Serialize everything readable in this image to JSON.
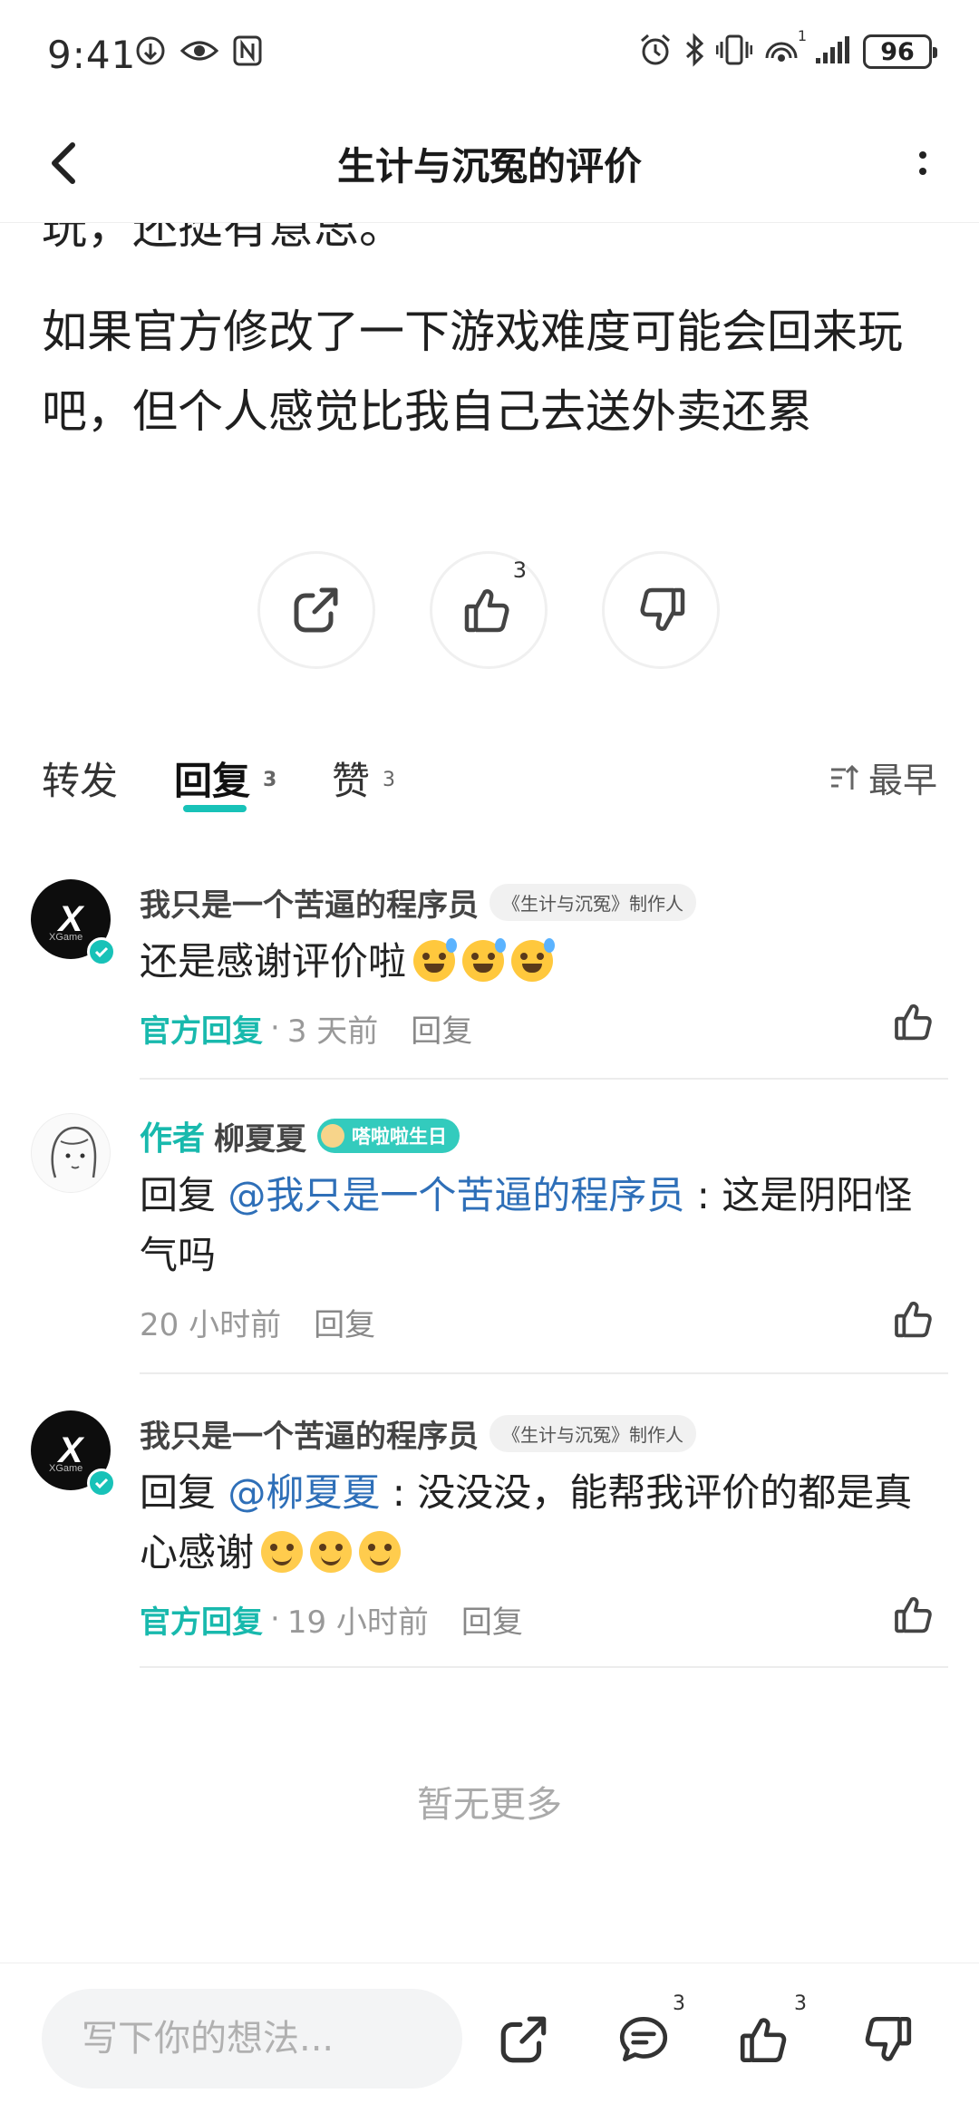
{
  "status_bar": {
    "time": "9:41",
    "battery": "96",
    "signal_sub": "1",
    "left_icons": [
      "data-saver-icon",
      "eye-icon",
      "nfc-icon"
    ],
    "right_icons": [
      "alarm-icon",
      "bluetooth-icon",
      "vibrate-icon",
      "hotspot-icon",
      "signal-icon",
      "battery-icon"
    ]
  },
  "header": {
    "title": "生计与沉冤的评价"
  },
  "review": {
    "clipped_line": "玩，还挺有意思。",
    "text": "如果官方修改了一下游戏难度可能会回来玩吧，但个人感觉比我自己去送外卖还累"
  },
  "actions": {
    "like_count": "3"
  },
  "tabs": {
    "repost": "转发",
    "reply": "回复",
    "reply_count": "3",
    "like": "赞",
    "like_count": "3",
    "sort": "最早"
  },
  "comments": [
    {
      "name": "我只是一个苦逼的程序员",
      "badge": "《生计与沉冤》制作人",
      "text": "还是感谢评价啦",
      "official": "官方回复",
      "time": "3 天前",
      "reply": "回复"
    },
    {
      "author_tag": "作者",
      "name": "柳夏夏",
      "badge": "嗒啦啦生日",
      "reply_prefix": "回复 ",
      "mention": "@我只是一个苦逼的程序员",
      "text": " : 这是阴阳怪气吗",
      "time": "20 小时前",
      "reply": "回复"
    },
    {
      "name": "我只是一个苦逼的程序员",
      "badge": "《生计与沉冤》制作人",
      "reply_prefix": "回复 ",
      "mention": "@柳夏夏",
      "text": " : 没没没，能帮我评价的都是真心感谢",
      "official": "官方回复",
      "time": "19 小时前",
      "reply": "回复"
    }
  ],
  "avatar_logo": {
    "mark": "X",
    "sub": "XGame"
  },
  "no_more": "暂无更多",
  "bottom_bar": {
    "placeholder": "写下你的想法...",
    "comment_count": "3",
    "like_count": "3"
  },
  "colors": {
    "accent": "#18c2b8",
    "mention": "#2e6fb8",
    "text": "#222222",
    "muted": "#999999"
  }
}
